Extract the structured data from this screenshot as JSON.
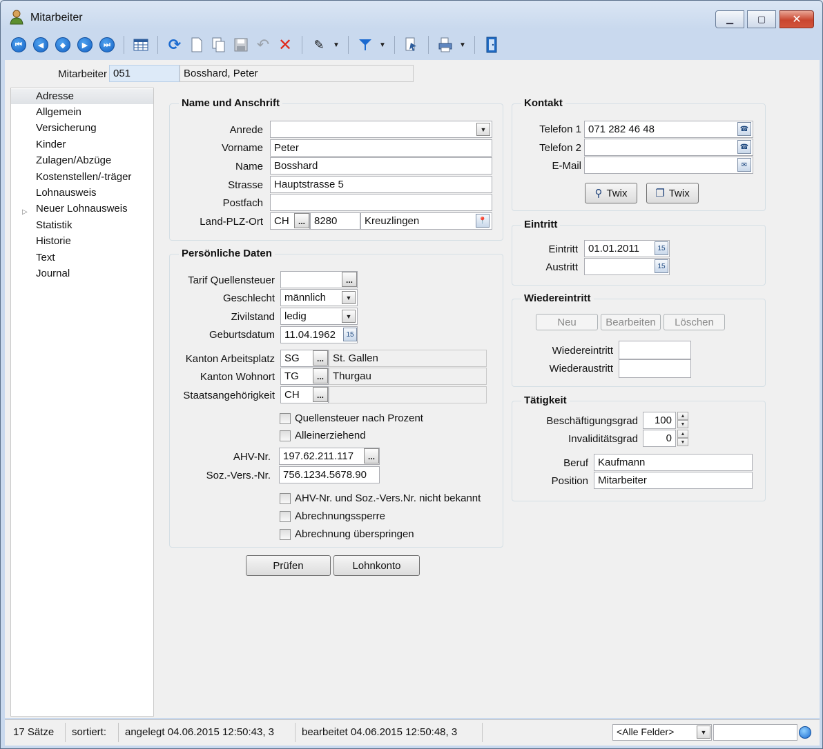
{
  "window": {
    "title": "Mitarbeiter"
  },
  "toolbar": {
    "icons": [
      "first-record-icon",
      "previous-record-icon",
      "jump-record-icon",
      "next-record-icon",
      "last-record-icon",
      "table-view-icon",
      "refresh-icon",
      "new-record-icon",
      "copy-record-icon",
      "save-icon",
      "undo-icon",
      "delete-icon",
      "search-icon",
      "filter-icon",
      "export-icon",
      "print-icon",
      "exit-icon"
    ]
  },
  "header": {
    "label": "Mitarbeiter",
    "number": "051",
    "name": "Bosshard, Peter"
  },
  "nav": {
    "items": [
      "Adresse",
      "Allgemein",
      "Versicherung",
      "Kinder",
      "Zulagen/Abzüge",
      "Kostenstellen/-träger",
      "Lohnausweis",
      "Neuer Lohnausweis",
      "Statistik",
      "Historie",
      "Text",
      "Journal"
    ]
  },
  "name_address": {
    "title": "Name und Anschrift",
    "labels": {
      "anrede": "Anrede",
      "vorname": "Vorname",
      "name": "Name",
      "strasse": "Strasse",
      "postfach": "Postfach",
      "land_plz_ort": "Land-PLZ-Ort"
    },
    "values": {
      "anrede": "",
      "vorname": "Peter",
      "name": "Bosshard",
      "strasse": "Hauptstrasse 5",
      "postfach": "",
      "land": "CH",
      "plz": "8280",
      "ort": "Kreuzlingen"
    }
  },
  "personal": {
    "title": "Persönliche Daten",
    "labels": {
      "tarif": "Tarif Quellensteuer",
      "geschlecht": "Geschlecht",
      "zivilstand": "Zivilstand",
      "geburtsdatum": "Geburtsdatum",
      "kanton_arbeitsplatz": "Kanton Arbeitsplatz",
      "kanton_wohnort": "Kanton Wohnort",
      "staatsangehoerigkeit": "Staatsangehörigkeit",
      "ahv": "AHV-Nr.",
      "sozvers": "Soz.-Vers.-Nr."
    },
    "values": {
      "tarif": "",
      "geschlecht": "männlich",
      "zivilstand": "ledig",
      "geburtsdatum": "11.04.1962",
      "kanton_arbeitsplatz_code": "SG",
      "kanton_arbeitsplatz_name": "St. Gallen",
      "kanton_wohnort_code": "TG",
      "kanton_wohnort_name": "Thurgau",
      "staatsangehoerigkeit_code": "CH",
      "staatsangehoerigkeit_name": "",
      "ahv": "197.62.211.117",
      "sozvers": "756.1234.5678.90"
    },
    "checks": {
      "quellensteuer_prozent": "Quellensteuer nach Prozent",
      "alleinerziehend": "Alleinerziehend",
      "nicht_bekannt": "AHV-Nr. und Soz.-Vers.Nr. nicht bekannt",
      "sperre": "Abrechnungssperre",
      "ueberspringen": "Abrechnung überspringen"
    }
  },
  "buttons": {
    "pruefen": "Prüfen",
    "lohnkonto": "Lohnkonto"
  },
  "kontakt": {
    "title": "Kontakt",
    "labels": {
      "telefon1": "Telefon 1",
      "telefon2": "Telefon 2",
      "email": "E-Mail"
    },
    "values": {
      "telefon1": "071 282 46 48",
      "telefon2": "",
      "email": ""
    },
    "twix1": "Twix",
    "twix2": "Twix"
  },
  "eintritt": {
    "title": "Eintritt",
    "labels": {
      "eintritt": "Eintritt",
      "austritt": "Austritt"
    },
    "values": {
      "eintritt": "01.01.2011",
      "austritt": ""
    }
  },
  "wiedereintritt": {
    "title": "Wiedereintritt",
    "buttons": {
      "neu": "Neu",
      "bearbeiten": "Bearbeiten",
      "loeschen": "Löschen"
    },
    "labels": {
      "wiedereintritt": "Wiedereintritt",
      "wiederaustritt": "Wiederaustritt"
    },
    "values": {
      "wiedereintritt": "",
      "wiederaustritt": ""
    }
  },
  "taetigkeit": {
    "title": "Tätigkeit",
    "labels": {
      "beschaeftigungsgrad": "Beschäftigungsgrad",
      "invaliditaetsgrad": "Invaliditätsgrad",
      "beruf": "Beruf",
      "position": "Position"
    },
    "values": {
      "beschaeftigungsgrad": "100",
      "invaliditaetsgrad": "0",
      "beruf": "Kaufmann",
      "position": "Mitarbeiter"
    }
  },
  "status": {
    "count": "17 Sätze",
    "sorted": "sortiert:",
    "created": "angelegt 04.06.2015 12:50:43,  3",
    "edited": "bearbeitet 04.06.2015 12:50:48,  3",
    "field_filter": "<Alle Felder>"
  }
}
